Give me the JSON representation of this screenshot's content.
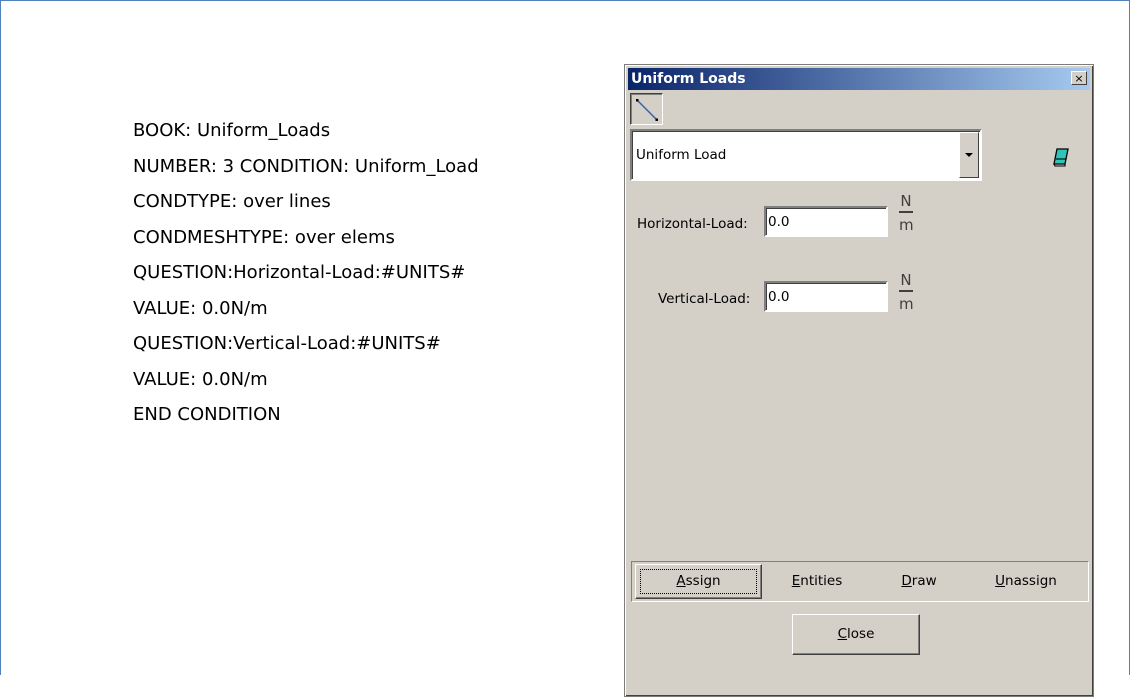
{
  "definition_lines": [
    "BOOK: Uniform_Loads",
    "NUMBER: 3 CONDITION: Uniform_Load",
    "CONDTYPE: over lines",
    "CONDMESHTYPE: over elems",
    "QUESTION:Horizontal-Load:#UNITS#",
    "VALUE: 0.0N/m",
    "QUESTION:Vertical-Load:#UNITS#",
    "VALUE: 0.0N/m",
    "END CONDITION"
  ],
  "dialog": {
    "title": "Uniform Loads",
    "close_glyph": "×",
    "condition_select": {
      "value": "Uniform Load"
    },
    "fields": [
      {
        "label": "Horizontal-Load:",
        "value": "0.0",
        "unit_numerator": "N",
        "unit_denominator": "m"
      },
      {
        "label": "Vertical-Load:",
        "value": "0.0",
        "unit_numerator": "N",
        "unit_denominator": "m"
      }
    ],
    "actions": {
      "assign": {
        "mnemonic": "A",
        "rest": "ssign"
      },
      "entities": {
        "mnemonic": "E",
        "rest": "ntities"
      },
      "draw": {
        "mnemonic": "D",
        "rest": "raw"
      },
      "unassign": {
        "mnemonic": "U",
        "rest": "nassign"
      }
    },
    "close_button": {
      "mnemonic": "C",
      "rest": "lose"
    }
  },
  "icons": {
    "line_entity": "line-icon",
    "book": "book-icon",
    "dropdown": "chevron-down-icon"
  },
  "colors": {
    "frame_border": "#4f81bd",
    "titlebar_start": "#0a246a",
    "titlebar_end": "#a6caf0",
    "dialog_bg": "#d4d0c8",
    "book_icon": "#26b3a8"
  }
}
